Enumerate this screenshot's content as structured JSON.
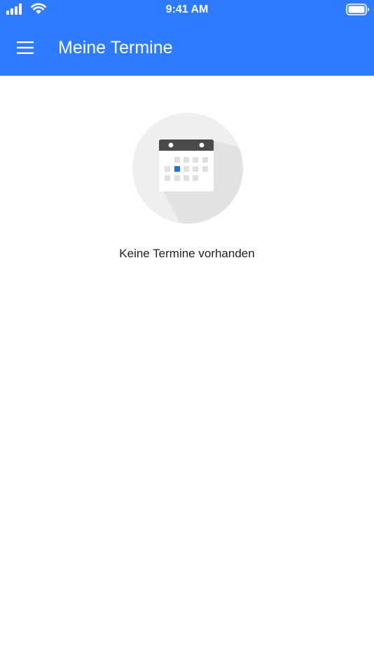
{
  "status_bar": {
    "time": "9:41 AM"
  },
  "app_bar": {
    "title": "Meine Termine",
    "menu_icon": "hamburger-menu-icon",
    "color": "#2F7BFF"
  },
  "empty_state": {
    "illustration": "calendar-icon",
    "message": "Keine Termine vorhanden",
    "highlight_color": "#1A73E8"
  }
}
